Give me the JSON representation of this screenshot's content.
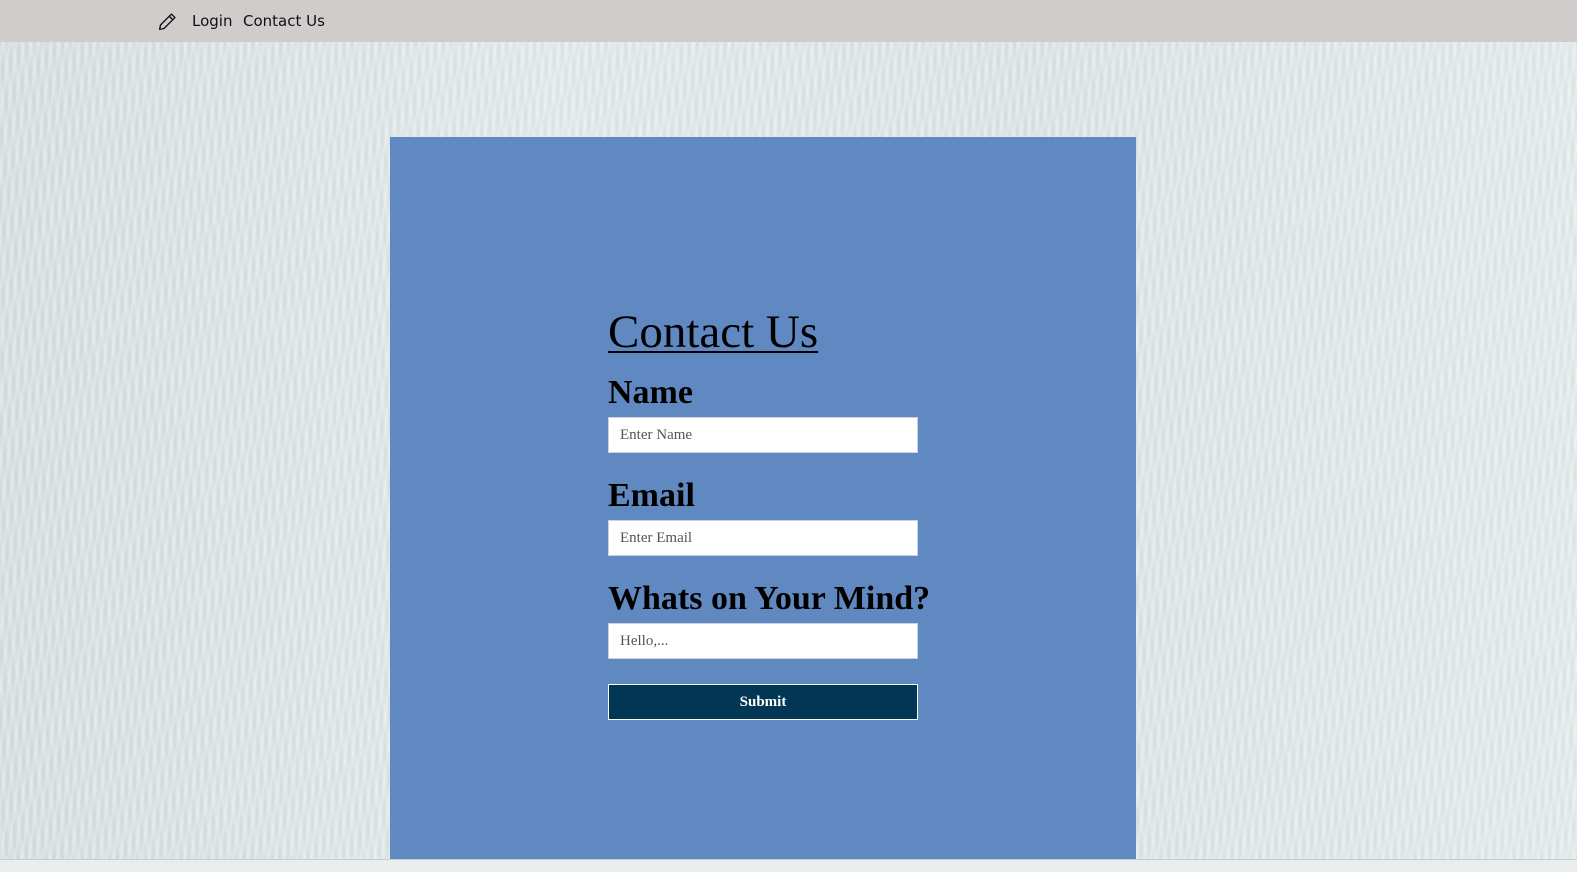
{
  "navbar": {
    "icon": "pencil-icon",
    "links": [
      "Login",
      "Contact Us"
    ],
    "background": "#d1cccc"
  },
  "panel": {
    "background": "#6189c1"
  },
  "form": {
    "title": "Contact Us",
    "name_label": "Name",
    "name_placeholder": "Enter Name",
    "email_label": "Email",
    "email_placeholder": "Enter Email",
    "message_label": "Whats on Your Mind?",
    "message_placeholder": "Hello,...",
    "submit_label": "Submit",
    "submit_color": "#023655"
  }
}
